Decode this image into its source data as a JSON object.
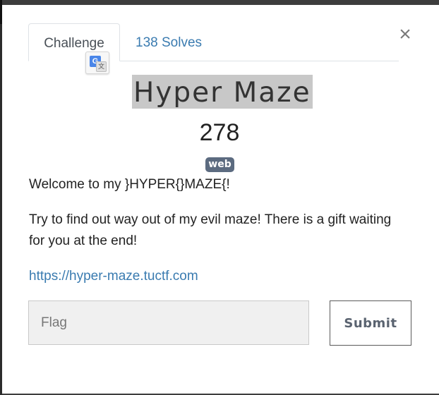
{
  "tabs": {
    "challenge_label": "Challenge",
    "solves_label": "138 Solves"
  },
  "close_label": "×",
  "translate": {
    "g_glyph": "G",
    "t_glyph": "文"
  },
  "challenge": {
    "name": "Hyper Maze",
    "value": "278",
    "category": "web",
    "description_line1": "Welcome to my }HYPER{}MAZE{!",
    "description_line2": "Try to find out way out of my evil maze! There is a gift waiting for you at the end!",
    "link": "https://hyper-maze.tuctf.com"
  },
  "form": {
    "flag_placeholder": "Flag",
    "flag_value": "",
    "submit_label": "Submit"
  },
  "colors": {
    "link": "#3a7bb0",
    "badge_bg": "#5c6b80",
    "title_highlight": "#c8c8c8"
  }
}
